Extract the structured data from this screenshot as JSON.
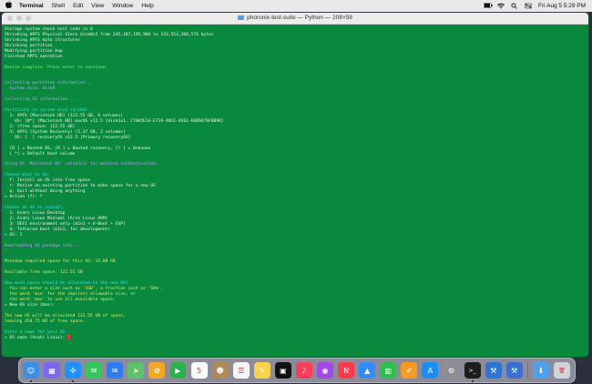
{
  "menubar": {
    "items": [
      "Terminal",
      "Shell",
      "Edit",
      "View",
      "Window",
      "Help"
    ],
    "clock": "Fri Aug 5  5:29 PM"
  },
  "window": {
    "title": "phoronix-test-suite — Python — 208×58"
  },
  "terminal": {
    "lines": [
      {
        "text": "Storage system check exit code is 0",
        "color": "white"
      },
      {
        "text": "Shrinking APFS Physical Store disk0s2 from 245,107,195,904 to 122,553,368,576 bytes",
        "color": "white"
      },
      {
        "text": "Shrinking APFS data structures",
        "color": "white"
      },
      {
        "text": "Shrinking partition",
        "color": "white"
      },
      {
        "text": "Modifying partition map",
        "color": "white"
      },
      {
        "text": "Finished APFS operation",
        "color": "white"
      },
      {
        "text": "",
        "color": "white"
      },
      {
        "text": "Resize complete. Press enter to continue.",
        "color": "green"
      },
      {
        "text": "",
        "color": "white"
      },
      {
        "text": "",
        "color": "white"
      },
      {
        "text": "Collecting partition information...",
        "color": "magenta"
      },
      {
        "text": "  System disk: disk0",
        "color": "magenta"
      },
      {
        "text": "",
        "color": "white"
      },
      {
        "text": "Collecting OS information...",
        "color": "magenta"
      },
      {
        "text": "",
        "color": "white"
      },
      {
        "text": "Partitions in system disk (disk0):",
        "color": "cyan"
      },
      {
        "text": "  1: APFS [Macintosh HD] (122.55 GB, 6 volumes)",
        "color": "white"
      },
      {
        "text": "    OS: [B*] [Macintosh HD] macOS v12.5 [disk3s1, C70A5E14-E719-48CE-8561-E009678FDB96]",
        "color": "white"
      },
      {
        "text": "  2: (free space: 122.55 GB)",
        "color": "white"
      },
      {
        "text": "  3: APFS (System Recovery) (5.37 GB, 2 volumes)",
        "color": "white"
      },
      {
        "text": "    OS: [  ] recoveryOS v12.5 [Primary recoveryOS]",
        "color": "white"
      },
      {
        "text": "",
        "color": "white"
      },
      {
        "text": "  [B ] = Booted OS, [R ] = Booted recovery, [? ] = Unknown",
        "color": "white"
      },
      {
        "text": "  [ *] = Default boot volume",
        "color": "white"
      },
      {
        "text": "",
        "color": "white"
      },
      {
        "text": "Using OS 'Macintosh HD' (disk3s1) for machine authentication.",
        "color": "magenta"
      },
      {
        "text": "",
        "color": "white"
      },
      {
        "text": "Choose what to do:",
        "color": "cyan"
      },
      {
        "text": "  f: Install an OS into free space",
        "color": "white"
      },
      {
        "text": "  r: Resize an existing partition to make space for a new OS",
        "color": "white"
      },
      {
        "text": "  q: Quit without doing anything",
        "color": "white"
      },
      {
        "text": "» Action (f): f",
        "color": "white"
      },
      {
        "text": "",
        "color": "white"
      },
      {
        "text": "Choose an OS to install:",
        "color": "cyan"
      },
      {
        "text": "  1: Asahi Linux Desktop",
        "color": "white"
      },
      {
        "text": "  2: Asahi Linux Minimal (Arch Linux ARM)",
        "color": "white"
      },
      {
        "text": "  3: UEFI environment only (m1n1 + U-Boot + ESP)",
        "color": "white"
      },
      {
        "text": "  4: Tethered boot (m1n1, for development)",
        "color": "white"
      },
      {
        "text": "» OS: 1",
        "color": "white"
      },
      {
        "text": "",
        "color": "white"
      },
      {
        "text": "Downloading OS package info...",
        "color": "magenta"
      },
      {
        "text": "-",
        "color": "white"
      },
      {
        "text": "",
        "color": "white"
      },
      {
        "text": "Minimum required space for this OS: 15.00 GB",
        "color": "yellow"
      },
      {
        "text": "",
        "color": "white"
      },
      {
        "text": "Available free space: 122.55 GB",
        "color": "yellow"
      },
      {
        "text": "",
        "color": "white"
      },
      {
        "text": "How much space should be allocated to the new OS?",
        "color": "cyan"
      },
      {
        "text": "  You can enter a size such as '1GB', a fraction such as '50%',",
        "color": "yellow"
      },
      {
        "text": "  the word 'min' for the smallest allowable size, or",
        "color": "yellow"
      },
      {
        "text": "  the word 'max' to use all available space.",
        "color": "yellow"
      },
      {
        "text": "» New OS size (max):",
        "color": "white"
      },
      {
        "text": "",
        "color": "white"
      },
      {
        "text": "The new OS will be allocated 122.55 GB of space,",
        "color": "yellow"
      },
      {
        "text": "leaving 458.75 KB of free space.",
        "color": "yellow"
      },
      {
        "text": "",
        "color": "white"
      },
      {
        "text": "Enter a name for your OS",
        "color": "cyan"
      },
      {
        "text": "» OS name (Asahi Linux):",
        "color": "white"
      }
    ]
  },
  "dock": {
    "apps": [
      {
        "name": "finder-icon",
        "color": "#3d8fe6",
        "glyph": "☺",
        "running": true
      },
      {
        "name": "launchpad-icon",
        "color": "#7b68ee",
        "glyph": "▦",
        "running": false
      },
      {
        "name": "safari-icon",
        "color": "#1e90ff",
        "glyph": "✣",
        "running": true
      },
      {
        "name": "messages-icon",
        "color": "#34c759",
        "glyph": "✉",
        "running": false
      },
      {
        "name": "mail-icon",
        "color": "#2d7cf6",
        "glyph": "✉",
        "running": false
      },
      {
        "name": "maps-icon",
        "color": "#5ec26a",
        "glyph": "➤",
        "running": false
      },
      {
        "name": "photos-icon",
        "color": "#f5a623",
        "glyph": "✿",
        "running": false
      },
      {
        "name": "facetime-icon",
        "color": "#29b34a",
        "glyph": "▶",
        "running": false
      },
      {
        "name": "calendar-icon",
        "color": "#ffffff",
        "glyph": "5",
        "running": false
      },
      {
        "name": "contacts-icon",
        "color": "#b08955",
        "glyph": "☻",
        "running": false
      },
      {
        "name": "reminders-icon",
        "color": "#f7f7f7",
        "glyph": "☰",
        "running": false
      },
      {
        "name": "notes-icon",
        "color": "#f8d34a",
        "glyph": "✎",
        "running": false
      },
      {
        "name": "tv-icon",
        "color": "#111111",
        "glyph": "▣",
        "running": false
      },
      {
        "name": "music-icon",
        "color": "#fa3e5a",
        "glyph": "♪",
        "running": false
      },
      {
        "name": "podcasts-icon",
        "color": "#a347e6",
        "glyph": "◉",
        "running": false
      },
      {
        "name": "news-icon",
        "color": "#ff3b4a",
        "glyph": "N",
        "running": false
      },
      {
        "name": "keynote-icon",
        "color": "#2f8cff",
        "glyph": "▲",
        "running": false
      },
      {
        "name": "numbers-icon",
        "color": "#2fbf4f",
        "glyph": "▥",
        "running": false
      },
      {
        "name": "pages-icon",
        "color": "#f59b23",
        "glyph": "✐",
        "running": false
      },
      {
        "name": "app-store-icon",
        "color": "#1b8ef5",
        "glyph": "A",
        "running": false
      },
      {
        "name": "system-preferences-icon",
        "color": "#8e8e93",
        "glyph": "⚙",
        "running": false
      },
      {
        "name": "terminal-icon",
        "color": "#1d1d1f",
        "glyph": ">_",
        "running": true
      },
      {
        "name": "xcode-icon",
        "color": "#2a76d6",
        "glyph": "⚒",
        "running": false
      },
      {
        "name": "xcode-beta-icon",
        "color": "#3b6fd4",
        "glyph": "⚒",
        "running": false
      },
      {
        "name": "downloads-folder-icon",
        "color": "#4fa0ef",
        "glyph": "⬇",
        "running": false
      },
      {
        "name": "trash-icon",
        "color": "#d0d3d8",
        "glyph": "🗑",
        "running": false
      }
    ]
  }
}
